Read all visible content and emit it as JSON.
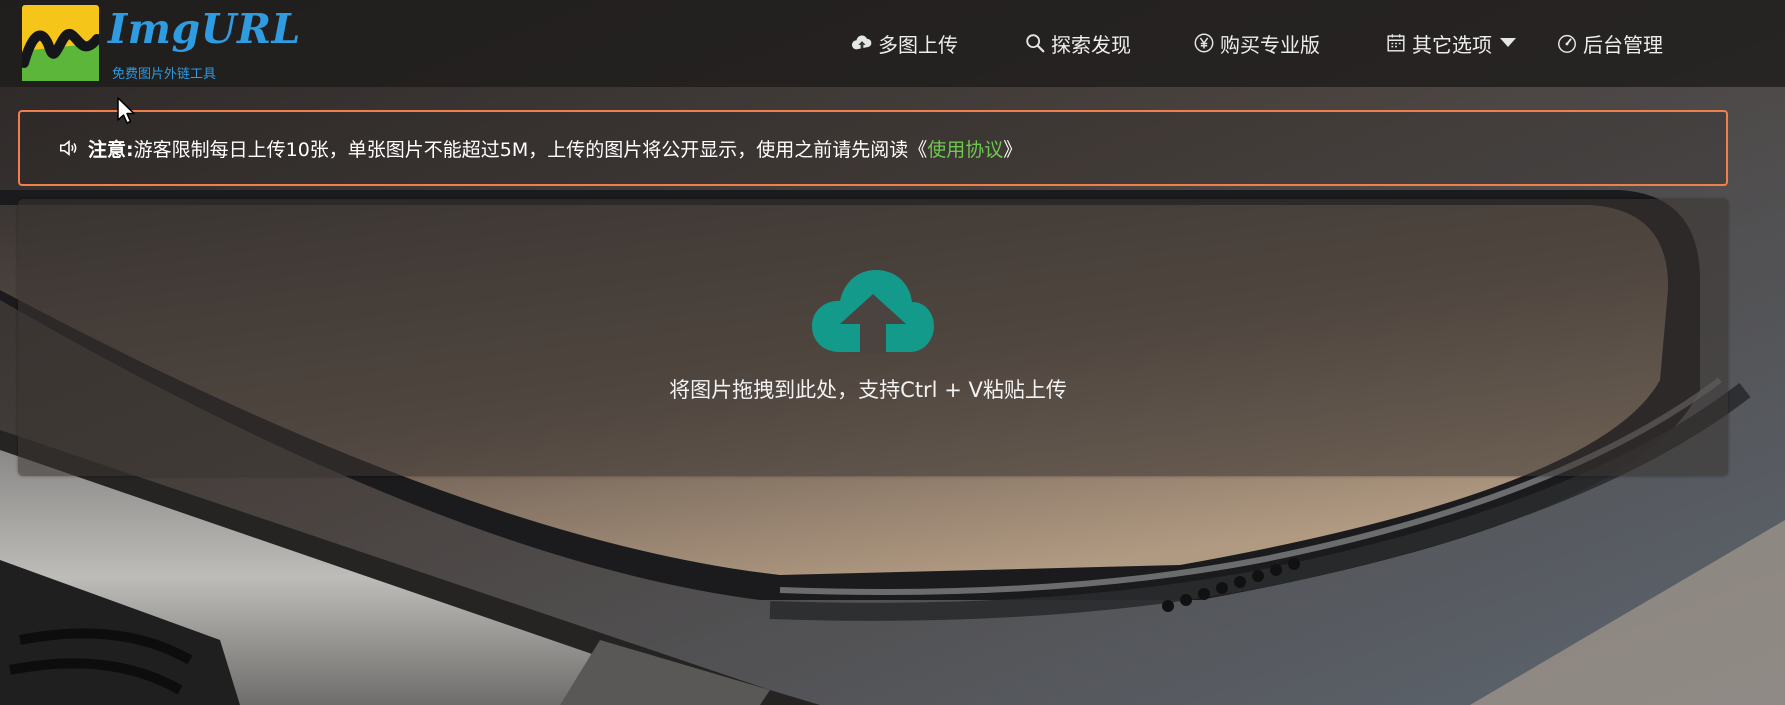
{
  "brand": {
    "title": "ImgURL",
    "subtitle": "免费图片外链工具"
  },
  "nav": {
    "items": [
      {
        "label": "多图上传",
        "icon": "cloud-upload-icon"
      },
      {
        "label": "探索发现",
        "icon": "search-icon"
      },
      {
        "label": "购买专业版",
        "icon": "yen-circle-icon"
      },
      {
        "label": "其它选项",
        "icon": "calendar-icon",
        "has_dropdown": true
      },
      {
        "label": "后台管理",
        "icon": "dashboard-gauge-icon"
      }
    ]
  },
  "notice": {
    "icon": "speaker-icon",
    "prefix": "注意:",
    "text": "游客限制每日上传10张，单张图片不能超过5M，上传的图片将公开显示，使用之前请先阅读《",
    "link_text": "使用协议",
    "suffix": "》"
  },
  "upload": {
    "icon": "cloud-upload-icon",
    "hint": "将图片拖拽到此处，支持Ctrl + V粘贴上传"
  },
  "colors": {
    "accent": "#2f9be0",
    "notice_border": "#ef7f4c",
    "link": "#6cc84f",
    "upload_icon": "#149a8a"
  }
}
